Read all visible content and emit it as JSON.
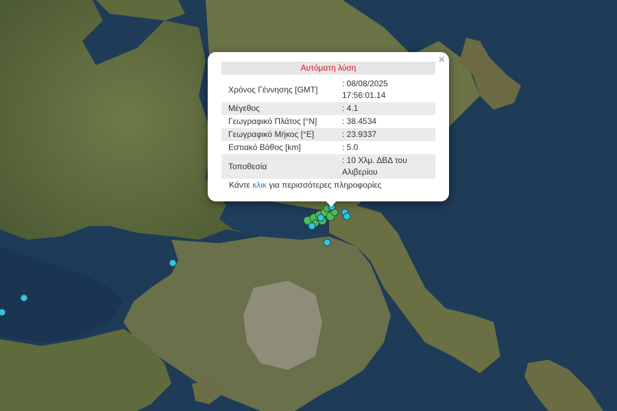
{
  "popup": {
    "title": "Αυτόματη λύση",
    "close_symbol": "×",
    "rows": [
      {
        "label": "Χρόνος Γέννησης [GMT]",
        "value": ": 08/08/2025 17:56:01.14"
      },
      {
        "label": "Μέγεθος",
        "value": ": 4.1"
      },
      {
        "label": "Γεωγραφικό Πλάτος [°N]",
        "value": ": 38.4534"
      },
      {
        "label": "Γεωγραφικό Μήκος [°E]",
        "value": ": 23.9337"
      },
      {
        "label": "Εστιακό Βάθος [km]",
        "value": ": 5.0"
      },
      {
        "label": "Τοποθεσία",
        "value": ": 10 Χλμ. ΔΒΔ του Αλιβερίου"
      }
    ],
    "footer_before": "Κάντε ",
    "footer_link": "κλικ",
    "footer_after": " για περισσότερες πληροφορίες"
  },
  "colors": {
    "sea": "#1d3a57",
    "land": "#5b6a3c",
    "marker_blue": "#35c3dc",
    "marker_green": "#4fbe5a",
    "title_red": "#e8101a",
    "link": "#2a7ac8"
  },
  "map": {
    "basemap": "satellite imagery",
    "markers": [
      {
        "type": "epicenter",
        "color": "cyan"
      },
      {
        "type": "cluster",
        "color": "green"
      }
    ]
  }
}
